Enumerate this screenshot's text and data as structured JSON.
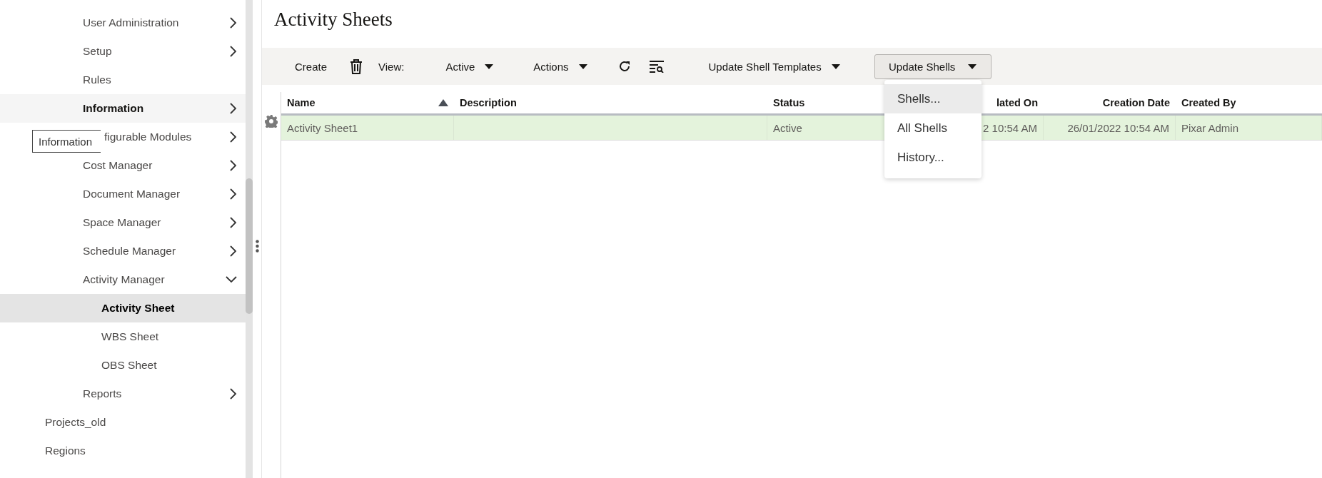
{
  "sidebar": {
    "subitems": [
      {
        "label": "User Administration",
        "kind": "folder",
        "expanded": false,
        "selected": false,
        "hovered": false
      },
      {
        "label": "Setup",
        "kind": "folder",
        "expanded": false,
        "selected": false,
        "hovered": false
      },
      {
        "label": "Rules",
        "kind": "leaf",
        "selected": false,
        "hovered": false
      },
      {
        "label": "Information",
        "kind": "folder",
        "expanded": false,
        "selected": false,
        "hovered": true
      },
      {
        "label": "figurable Modules",
        "kind": "folder",
        "expanded": false,
        "selected": false,
        "hovered": false,
        "tooltip": "Information"
      },
      {
        "label": "Cost Manager",
        "kind": "folder",
        "expanded": false,
        "selected": false,
        "hovered": false
      },
      {
        "label": "Document Manager",
        "kind": "folder",
        "expanded": false,
        "selected": false,
        "hovered": false
      },
      {
        "label": "Space Manager",
        "kind": "folder",
        "expanded": false,
        "selected": false,
        "hovered": false
      },
      {
        "label": "Schedule Manager",
        "kind": "folder",
        "expanded": false,
        "selected": false,
        "hovered": false
      },
      {
        "label": "Activity Manager",
        "kind": "folder",
        "expanded": true,
        "selected": false,
        "hovered": false,
        "children": [
          {
            "label": "Activity Sheet",
            "kind": "leaf",
            "selected": true,
            "hovered": false
          },
          {
            "label": "WBS Sheet",
            "kind": "leaf",
            "selected": false,
            "hovered": false
          },
          {
            "label": "OBS Sheet",
            "kind": "leaf",
            "selected": false,
            "hovered": false
          }
        ]
      },
      {
        "label": "Reports",
        "kind": "folder",
        "expanded": false,
        "selected": false,
        "hovered": false
      }
    ],
    "items": [
      {
        "label": "Projects_old",
        "kind": "leaf",
        "selected": false,
        "hovered": false
      },
      {
        "label": "Regions",
        "kind": "leaf",
        "selected": false,
        "hovered": false
      }
    ]
  },
  "page_title": "Activity Sheets",
  "toolbar": [
    {
      "kind": "button",
      "label": "Create"
    },
    {
      "kind": "delete"
    },
    {
      "kind": "label",
      "label": "View:"
    },
    {
      "kind": "menu",
      "label": "Active"
    },
    {
      "kind": "menu",
      "label": "Actions"
    },
    {
      "kind": "refresh"
    },
    {
      "kind": "filter"
    },
    {
      "kind": "menu",
      "label": "Update Shell Templates"
    },
    {
      "kind": "menubutton",
      "label": "Update Shells"
    }
  ],
  "dropdown_menu": {
    "items": [
      {
        "label": "Shells...",
        "selected": true
      },
      {
        "label": "All Shells",
        "selected": false
      },
      {
        "label": "History...",
        "selected": false
      }
    ]
  },
  "table": {
    "columns": [
      {
        "label": "Name",
        "sorted": true
      },
      {
        "label": "Description",
        "sorted": false
      },
      {
        "label": "Status",
        "sorted": false
      },
      {
        "label": "lated On",
        "sorted": false
      },
      {
        "label": "Creation Date",
        "sorted": false
      },
      {
        "label": "Created By",
        "sorted": false
      }
    ],
    "rows": [
      {
        "selected": true,
        "cells": [
          "Activity Sheet1",
          null,
          "Active",
          "2 10:54 AM",
          "26/01/2022 10:54 AM",
          "Pixar Admin"
        ]
      }
    ]
  }
}
